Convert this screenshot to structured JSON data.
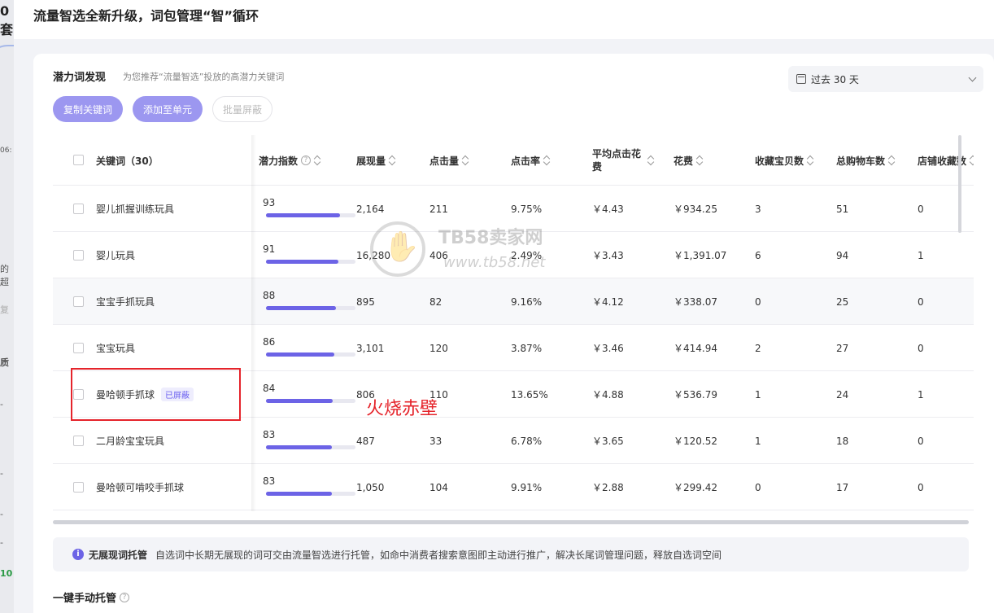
{
  "background": {
    "fragments": [
      "0套",
      "06:",
      "的超",
      "复",
      "质",
      "-",
      "-",
      "-",
      "-",
      "10"
    ]
  },
  "drawer": {
    "title": "流量智选全新升级，词包管理“智”循环"
  },
  "section": {
    "title": "潜力词发现",
    "subtitle": "为您推荐“流量智选”投放的高潜力关键词",
    "date_range": "过去 30 天"
  },
  "buttons": {
    "copy": "复制关键词",
    "add_unit": "添加至单元",
    "batch_block": "批量屏蔽"
  },
  "table": {
    "columns": [
      "关键词（30）",
      "潜力指数",
      "展现量",
      "点击量",
      "点击率",
      "平均点击花费",
      "花费",
      "收藏宝贝数",
      "总购物车数",
      "店铺收藏数"
    ],
    "rows": [
      {
        "keyword": "婴儿抓握训练玩具",
        "tag": "",
        "potential": 93,
        "impressions": "2,164",
        "clicks": "211",
        "ctr": "9.75%",
        "cpc": "￥4.43",
        "cost": "￥934.25",
        "fav_items": "3",
        "cart": "51",
        "shop_fav": "0"
      },
      {
        "keyword": "婴儿玩具",
        "tag": "",
        "potential": 91,
        "impressions": "16,280",
        "clicks": "406",
        "ctr": "2.49%",
        "cpc": "￥3.43",
        "cost": "￥1,391.07",
        "fav_items": "6",
        "cart": "94",
        "shop_fav": "1"
      },
      {
        "keyword": "宝宝手抓玩具",
        "tag": "",
        "potential": 88,
        "impressions": "895",
        "clicks": "82",
        "ctr": "9.16%",
        "cpc": "￥4.12",
        "cost": "￥338.07",
        "fav_items": "0",
        "cart": "25",
        "shop_fav": "0"
      },
      {
        "keyword": "宝宝玩具",
        "tag": "",
        "potential": 86,
        "impressions": "3,101",
        "clicks": "120",
        "ctr": "3.87%",
        "cpc": "￥3.46",
        "cost": "￥414.94",
        "fav_items": "2",
        "cart": "27",
        "shop_fav": "0"
      },
      {
        "keyword": "曼哈顿手抓球",
        "tag": "已屏蔽",
        "potential": 84,
        "impressions": "806",
        "clicks": "110",
        "ctr": "13.65%",
        "cpc": "￥4.88",
        "cost": "￥536.79",
        "fav_items": "1",
        "cart": "24",
        "shop_fav": "1"
      },
      {
        "keyword": "二月龄宝宝玩具",
        "tag": "",
        "potential": 83,
        "impressions": "487",
        "clicks": "33",
        "ctr": "6.78%",
        "cpc": "￥3.65",
        "cost": "￥120.52",
        "fav_items": "1",
        "cart": "18",
        "shop_fav": "0"
      },
      {
        "keyword": "曼哈顿可啃咬手抓球",
        "tag": "",
        "potential": 83,
        "impressions": "1,050",
        "clicks": "104",
        "ctr": "9.91%",
        "cpc": "￥2.88",
        "cost": "￥299.42",
        "fav_items": "0",
        "cart": "17",
        "shop_fav": "0"
      }
    ]
  },
  "annotation": {
    "red_note": "火烧赤壁"
  },
  "watermark": {
    "line1": "TB58卖家网",
    "line2": "www.tb58.net"
  },
  "info_bar": {
    "title": "无展现词托管",
    "text": "自选词中长期无展现的词可交由流量智选进行托管，如命中消费者搜索意图即主动进行推广，解决长尾词管理问题，释放自选词空间"
  },
  "section2": {
    "title": "一键手动托管"
  },
  "colors": {
    "accent": "#6c63e6",
    "button_primary": "#9c97f0",
    "annotation_red": "#e5242b"
  }
}
